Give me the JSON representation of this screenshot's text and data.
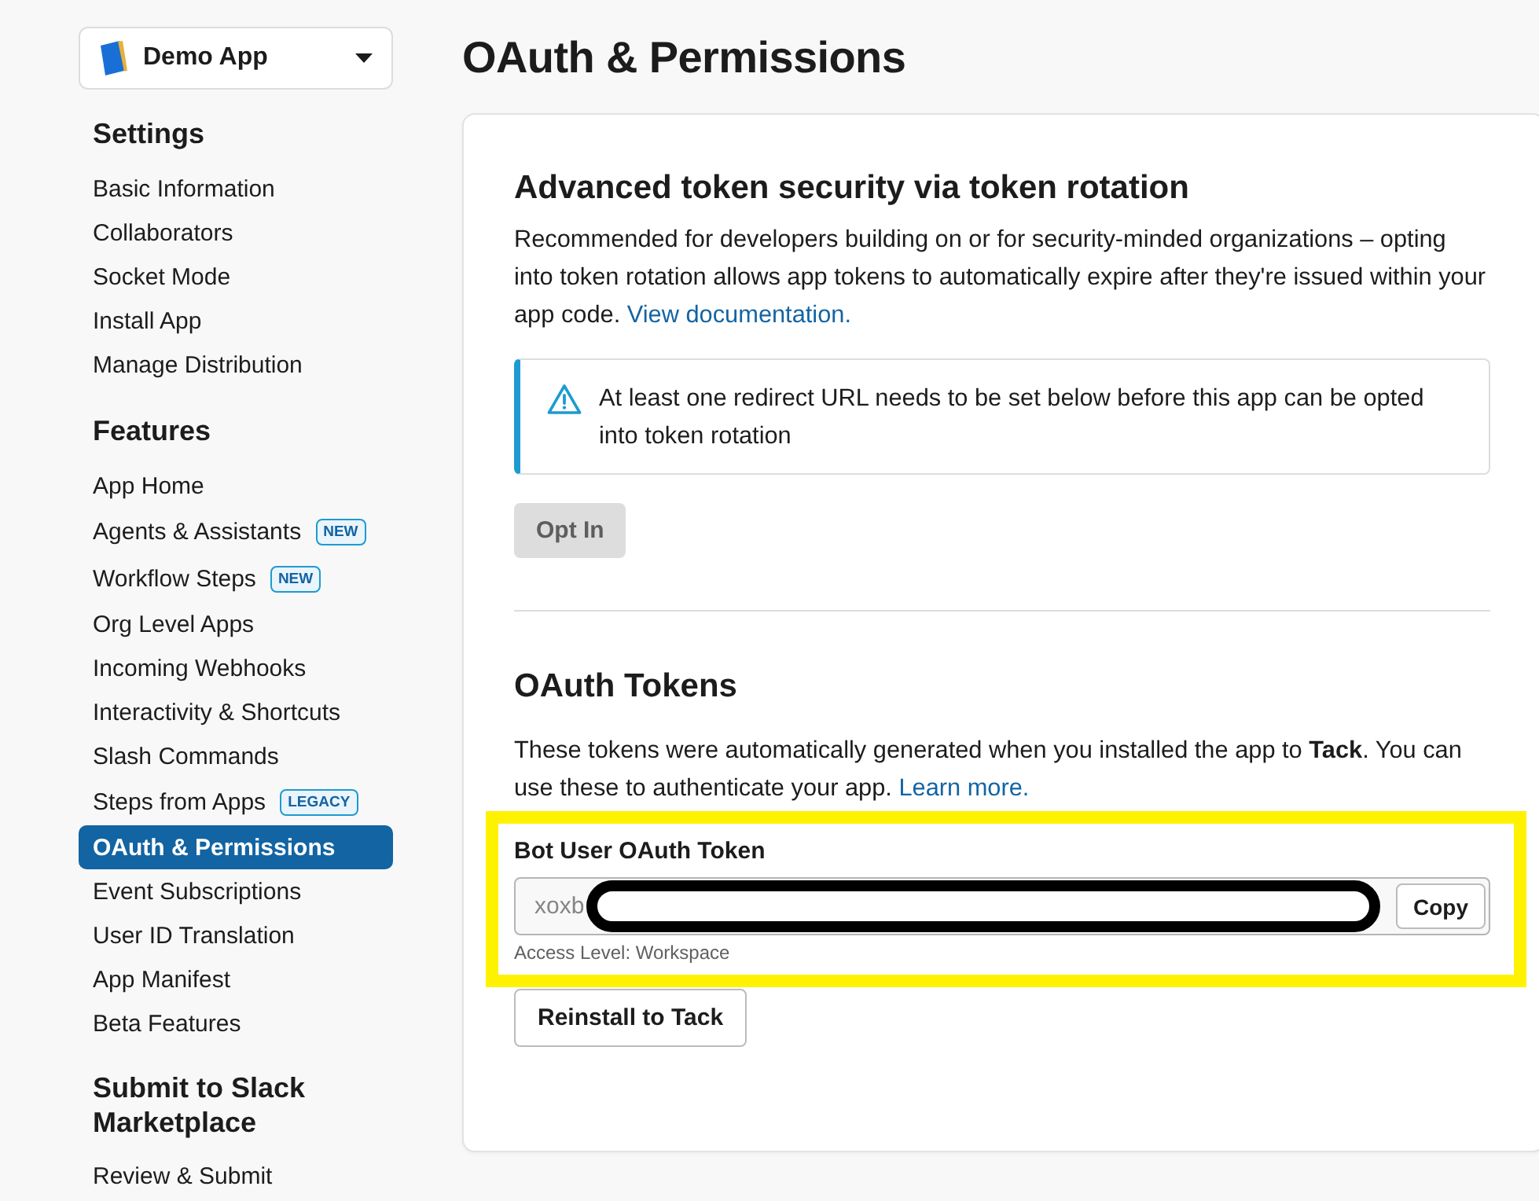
{
  "app_switcher": {
    "name": "Demo App"
  },
  "sidebar": {
    "sections": [
      {
        "heading": "Settings",
        "items": [
          {
            "label": "Basic Information",
            "selected": false
          },
          {
            "label": "Collaborators",
            "selected": false
          },
          {
            "label": "Socket Mode",
            "selected": false
          },
          {
            "label": "Install App",
            "selected": false
          },
          {
            "label": "Manage Distribution",
            "selected": false
          }
        ]
      },
      {
        "heading": "Features",
        "items": [
          {
            "label": "App Home",
            "selected": false
          },
          {
            "label": "Agents & Assistants",
            "badge": "NEW",
            "selected": false
          },
          {
            "label": "Workflow Steps",
            "badge": "NEW",
            "selected": false
          },
          {
            "label": "Org Level Apps",
            "selected": false
          },
          {
            "label": "Incoming Webhooks",
            "selected": false
          },
          {
            "label": "Interactivity & Shortcuts",
            "selected": false
          },
          {
            "label": "Slash Commands",
            "selected": false
          },
          {
            "label": "Steps from Apps",
            "badge": "LEGACY",
            "selected": false
          },
          {
            "label": "OAuth & Permissions",
            "selected": true
          },
          {
            "label": "Event Subscriptions",
            "selected": false
          },
          {
            "label": "User ID Translation",
            "selected": false
          },
          {
            "label": "App Manifest",
            "selected": false
          },
          {
            "label": "Beta Features",
            "selected": false
          }
        ]
      },
      {
        "heading": "Submit to Slack Marketplace",
        "items": [
          {
            "label": "Review & Submit",
            "selected": false
          }
        ]
      }
    ]
  },
  "page": {
    "title": "OAuth & Permissions"
  },
  "token_rotation": {
    "heading": "Advanced token security via token rotation",
    "description": "Recommended for developers building on or for security-minded organizations – opting into token rotation allows app tokens to automatically expire after they're issued within your app code.",
    "link": "View documentation.",
    "alert": "At least one redirect URL needs to be set below before this app can be opted into token rotation",
    "button": {
      "label": "Opt In",
      "disabled": true
    }
  },
  "oauth_tokens": {
    "heading": "OAuth Tokens",
    "description": "These tokens were automatically generated when you installed the app to **Tack**. You can use these to authenticate your app.",
    "link": "Learn more.",
    "tokens": [
      {
        "label": "Bot User OAuth Token",
        "value": "xoxb",
        "redacted": true,
        "highlighted": true,
        "copy_button": "Copy",
        "note": "Access Level: Workspace"
      }
    ],
    "button": "Reinstall to Tack"
  }
}
